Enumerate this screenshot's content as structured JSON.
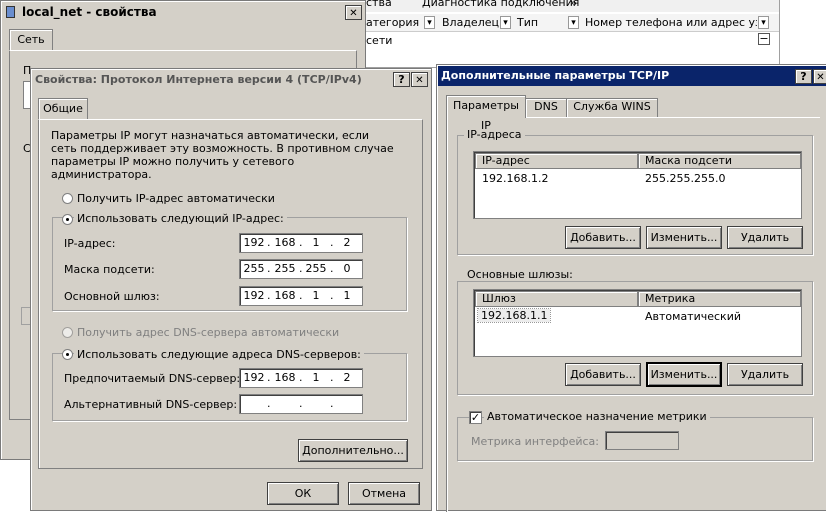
{
  "bg_explorer": {
    "columns": [
      "атегория сети",
      "Владелец",
      "Тип",
      "Номер телефона или адрес узла"
    ],
    "top_strip": [
      "ства",
      "Диагностика подключения",
      "»"
    ],
    "collapse_glyph": "⊟"
  },
  "local_net": {
    "title": "local_net - свойства",
    "tab": "Сеть",
    "fragments": [
      "П",
      "С"
    ]
  },
  "ipv4": {
    "title": "Свойства: Протокол Интернета версии 4 (TCP/IPv4)",
    "tab": "Общие",
    "description": "Параметры IP могут назначаться автоматически, если сеть поддерживает эту возможность. В противном случае параметры IP можно получить у сетевого администратора.",
    "radio_auto_ip": "Получить IP-адрес автоматически",
    "radio_manual_ip": "Использовать следующий IP-адрес:",
    "ip_label": "IP-адрес:",
    "mask_label": "Маска подсети:",
    "gateway_label": "Основной шлюз:",
    "ip": [
      "192",
      "168",
      "1",
      "2"
    ],
    "mask": [
      "255",
      "255",
      "255",
      "0"
    ],
    "gateway": [
      "192",
      "168",
      "1",
      "1"
    ],
    "radio_auto_dns": "Получить адрес DNS-сервера автоматически",
    "radio_manual_dns": "Использовать следующие адреса DNS-серверов:",
    "pref_dns_label": "Предпочитаемый DNS-сервер:",
    "alt_dns_label": "Альтернативный DNS-сервер:",
    "pref_dns": [
      "192",
      "168",
      "1",
      "2"
    ],
    "alt_dns": [
      "",
      "",
      "",
      ""
    ],
    "advanced_button": "Дополнительно...",
    "ok_button": "ОК",
    "cancel_button": "Отмена"
  },
  "advanced": {
    "title": "Дополнительные параметры TCP/IP",
    "tabs": [
      "Параметры IP",
      "DNS",
      "Служба WINS"
    ],
    "ip_group": "IP-адреса",
    "ip_col1": "IP-адрес",
    "ip_col2": "Маска подсети",
    "ip_rows": [
      {
        "a": "192.168.1.2",
        "b": "255.255.255.0"
      }
    ],
    "gw_group": "Основные шлюзы:",
    "gw_col1": "Шлюз",
    "gw_col2": "Метрика",
    "gw_rows": [
      {
        "a": "192.168.1.1",
        "b": "Автоматический"
      }
    ],
    "add_button": "Добавить...",
    "edit_button": "Изменить...",
    "delete_button": "Удалить",
    "auto_metric": "Автоматическое назначение метрики",
    "metric_label": "Метрика интерфейса:",
    "metric_value": ""
  },
  "glyphs": {
    "help": "?",
    "close": "✕",
    "check": "✓",
    "dropdown": "▾"
  }
}
